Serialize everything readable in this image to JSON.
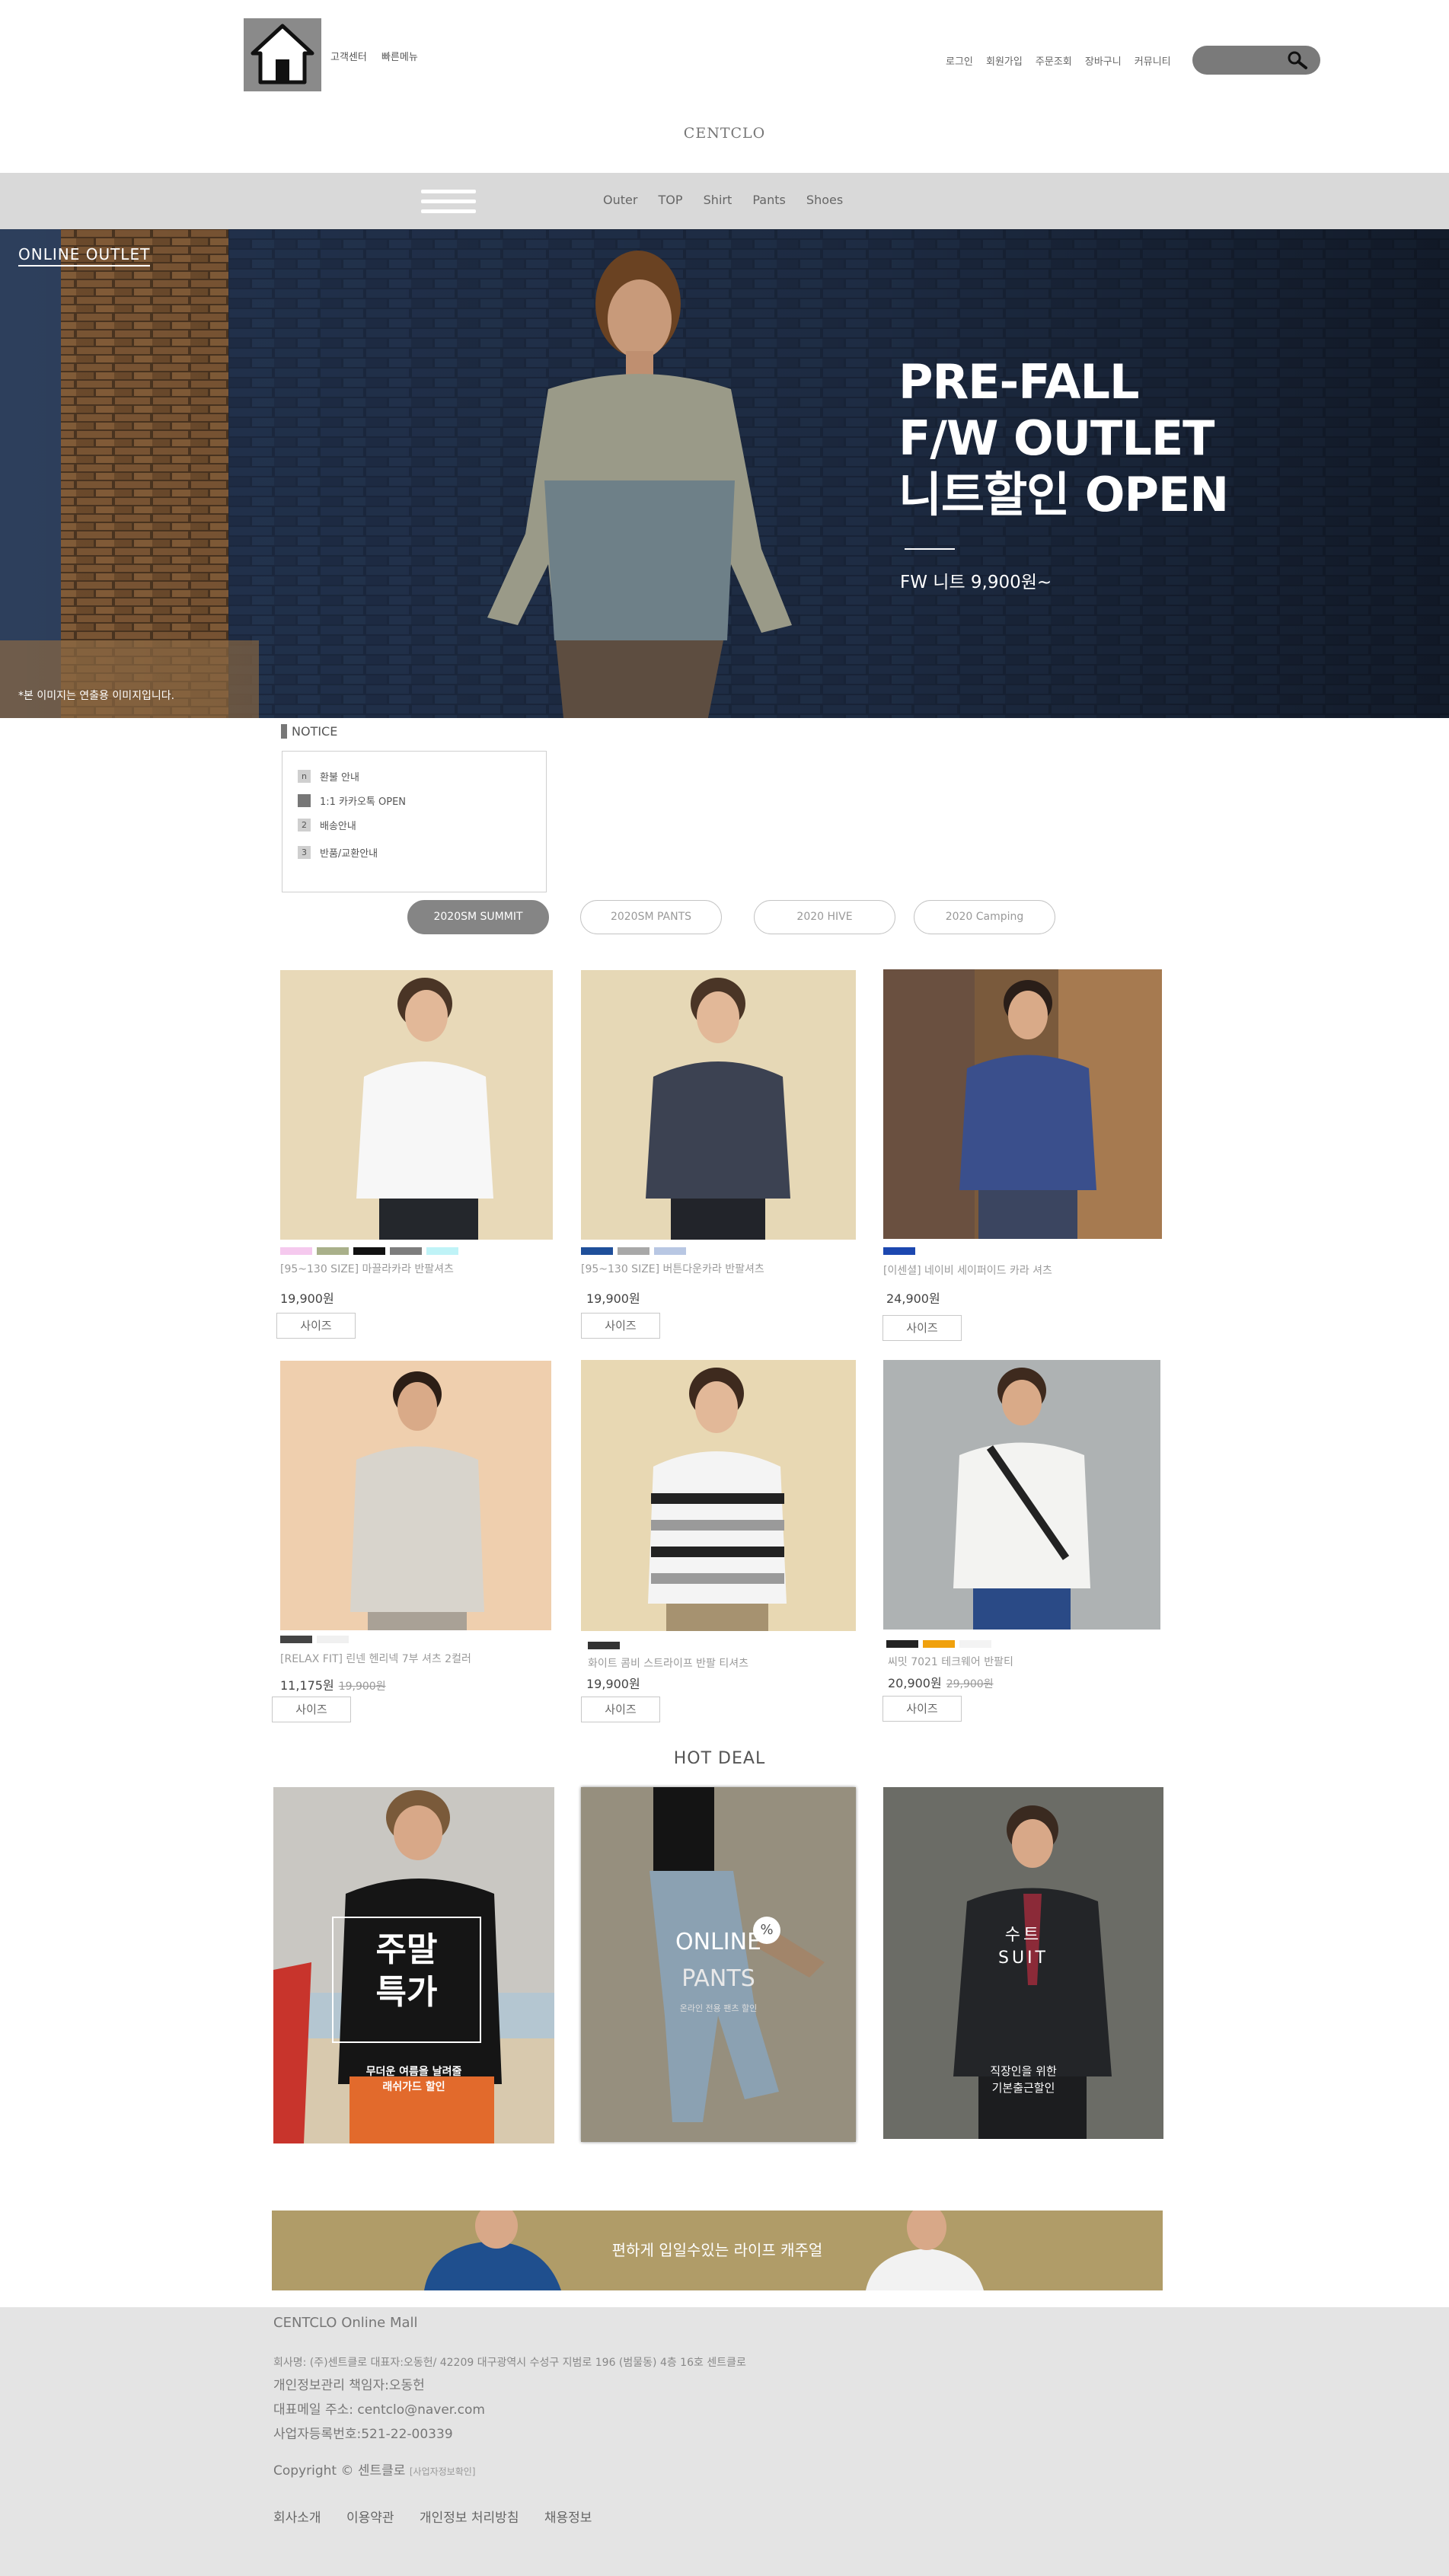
{
  "header": {
    "util_left": [
      "고객센터",
      "빠른메뉴"
    ],
    "util_right": [
      "로그인",
      "회원가입",
      "주문조회",
      "장바구니",
      "커뮤니티"
    ],
    "brand": "CENTCLO"
  },
  "nav": {
    "items": [
      "Outer",
      "TOP",
      "Shirt",
      "Pants",
      "Shoes"
    ]
  },
  "hero": {
    "tag": "ONLINE OUTLET",
    "title_lines": [
      "PRE-FALL",
      "F/W OUTLET",
      "니트할인 OPEN"
    ],
    "subtitle": "FW 니트 9,900원~",
    "note": "*본 이미지는 연출용 이미지입니다."
  },
  "notice": {
    "title": "NOTICE",
    "items": [
      {
        "badge": "n",
        "text": "환불 안내"
      },
      {
        "badge": "",
        "text": "1:1 카카오톡 OPEN"
      },
      {
        "badge": "2",
        "text": "배송안내"
      },
      {
        "badge": "3",
        "text": "반품/교환안내"
      }
    ]
  },
  "tabs": [
    "2020SM SUMMIT",
    "2020SM PANTS",
    "2020 HIVE",
    "2020 Camping"
  ],
  "products": [
    {
      "name": "[95~130 SIZE] 마끌라카라 반팔셔츠",
      "price": "19,900원",
      "old_price": "",
      "size_label": "사이즈",
      "swatches": [
        "#f5c9ee",
        "#a9b08a",
        "#111111",
        "#7d7d7d",
        "#bff3f7"
      ]
    },
    {
      "name": "[95~130 SIZE] 버튼다운카라 반팔셔츠",
      "price": "19,900원",
      "old_price": "",
      "size_label": "사이즈",
      "swatches": [
        "#1f4f9a",
        "#a8a8a8",
        "#b8c7e3"
      ]
    },
    {
      "name": "[이센셜] 네이비 세이퍼이드 카라 셔츠",
      "price": "24,900원",
      "old_price": "",
      "size_label": "사이즈",
      "swatches": [
        "#1c47b0"
      ]
    },
    {
      "name": "[RELAX FIT] 린넨 헨리넥 7부 셔츠 2컬러",
      "price": "11,175원",
      "old_price": "19,900원",
      "size_label": "사이즈",
      "swatches": [
        "#444444",
        "#f0f0f0"
      ]
    },
    {
      "name": "화이트 콤비 스트라이프 반팔 티셔츠",
      "price": "19,900원",
      "old_price": "",
      "size_label": "사이즈",
      "swatches": [
        "#333333"
      ]
    },
    {
      "name": "씨밋 7021 테크웨어 반팔티",
      "price": "20,900원",
      "old_price": "29,900원",
      "size_label": "사이즈",
      "swatches": [
        "#222222",
        "#f0a10d",
        "#f3f3f3"
      ]
    }
  ],
  "hot_deal": {
    "title": "HOT DEAL",
    "cards": [
      {
        "title_lines": [
          "주말",
          "특가"
        ],
        "caption_lines": [
          "무더운 여름을 날려줄",
          "래쉬가드 할인"
        ],
        "theme": "weekend-sale"
      },
      {
        "title_lines": [
          "ONLINE",
          "PANTS"
        ],
        "caption_lines": [
          "온라인 전용 팬츠 할인"
        ],
        "badge": "%",
        "theme": "online-pants"
      },
      {
        "title_lines": [
          "수트",
          "SUIT"
        ],
        "caption_lines": [
          "직장인을 위한",
          "기본출근할인"
        ],
        "theme": "suit"
      }
    ]
  },
  "banner": {
    "text": "편하게 입일수있는 라이프 캐주얼"
  },
  "footer": {
    "title": "CENTCLO Online Mall",
    "company": "회사명: (주)센트클로 대표자:오동헌/ 42209 대구광역시 수성구 지범로 196 (범물동) 4층 16호 센트클로",
    "privacy": "개인정보관리 책임자:오동헌",
    "email": "대표메일 주소: centclo@naver.com",
    "biz_no": "사업자등록번호:521-22-00339",
    "copyright": "Copyright © 센트클로",
    "biz_info": "[사업자정보확인]",
    "links": [
      "회사소개",
      "이용약관",
      "개인정보 처리방침",
      "채용정보"
    ]
  },
  "colors": {
    "nav_bg": "#d9d9d9",
    "footer_bg": "#e4e4e4",
    "banner_bg": "#b09c68",
    "active_tab": "#858585"
  },
  "icons": {
    "logo": "house-icon",
    "search": "search-icon",
    "menu": "hamburger-icon"
  }
}
